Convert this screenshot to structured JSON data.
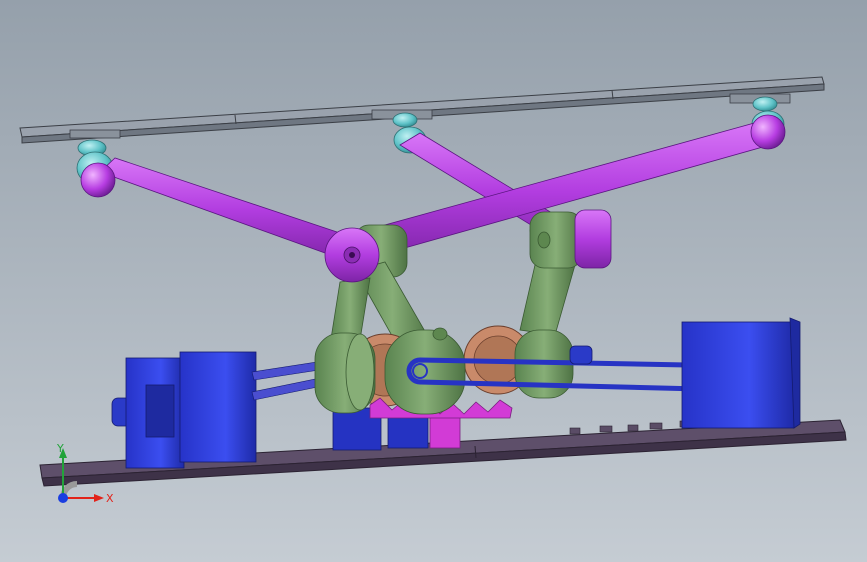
{
  "viewport": {
    "background_top": "#97a2ad",
    "background_bottom": "#c3cad1"
  },
  "colors": {
    "rod": "#b43ce0",
    "rod_light": "#d067f5",
    "rod_dark": "#7a1fa3",
    "arm": "#6e9a5f",
    "arm_light": "#8db57b",
    "arm_dark": "#4f7545",
    "motor": "#2f3fe0",
    "motor_light": "#4a5cf2",
    "motor_dark": "#1a2396",
    "gear": "#c98a6a",
    "gear_dark": "#8c5a43",
    "joint": "#5fc3c8",
    "plate": "#7e8793",
    "base": "#4a3c5a",
    "magenta": "#d23bd6"
  },
  "axes": {
    "x_label": "X",
    "y_label": "Y",
    "x_color": "#e2231a",
    "y_color": "#22a33a",
    "z_color": "#1a3ee0"
  },
  "icons": {
    "triad": "coordinate-triad-icon"
  }
}
